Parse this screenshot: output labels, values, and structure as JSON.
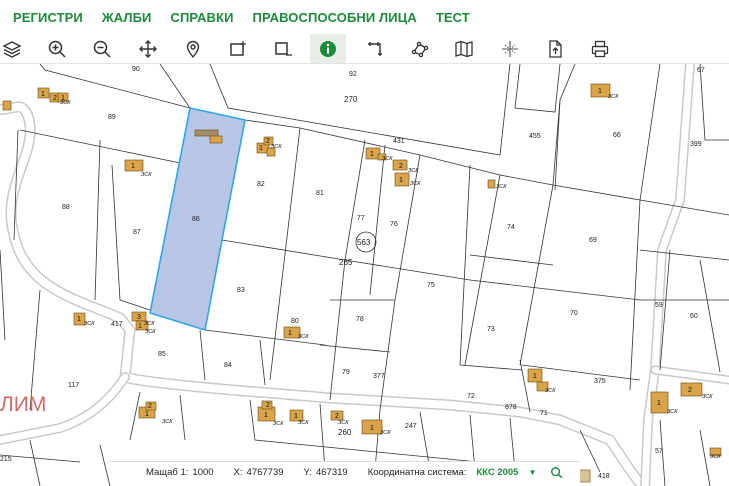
{
  "menu": {
    "items": [
      {
        "label": "РЕГИСТРИ"
      },
      {
        "label": "ЖАЛБИ"
      },
      {
        "label": "СПРАВКИ"
      },
      {
        "label": "ПРАВОСПОСОБНИ ЛИЦА"
      },
      {
        "label": "ТЕСТ"
      }
    ]
  },
  "toolbar": {
    "tools": [
      {
        "icon": "layers-icon"
      },
      {
        "icon": "zoom-in-icon"
      },
      {
        "icon": "zoom-out-icon"
      },
      {
        "icon": "pan-icon"
      },
      {
        "icon": "location-pin-icon"
      },
      {
        "icon": "select-rectangle-icon"
      },
      {
        "icon": "deselect-rectangle-icon"
      },
      {
        "icon": "info-icon",
        "active": true
      },
      {
        "icon": "measure-distance-icon"
      },
      {
        "icon": "measure-area-icon"
      },
      {
        "icon": "map-icon"
      },
      {
        "icon": "coordinates-icon"
      },
      {
        "icon": "export-icon"
      },
      {
        "icon": "print-icon"
      }
    ]
  },
  "map": {
    "selection_color": "#b8c6e6",
    "selection_stroke": "#2fa6e6",
    "building_color": "#d9a44a",
    "road_stroke": "#c9c9c9",
    "parcels": [
      "90",
      "92",
      "270",
      "89",
      "431",
      "455",
      "66",
      "399",
      "67",
      "88",
      "86",
      "82",
      "81",
      "77",
      "76",
      "563",
      "265",
      "87",
      "74",
      "69",
      "83",
      "75",
      "80",
      "78",
      "73",
      "59",
      "70",
      "60",
      "417",
      "85",
      "84",
      "79",
      "377",
      "375",
      "117",
      "72",
      "878",
      "71",
      "260",
      "247",
      "57",
      "418",
      "215"
    ],
    "building_labels": [
      "1",
      "2",
      "3"
    ],
    "building_tag": "ЗСК",
    "watermark": "ЛИМ"
  },
  "status": {
    "scale_label": "Мащаб 1:",
    "scale_value": "1000",
    "x_label": "X:",
    "x_value": "4767739",
    "y_label": "Y:",
    "y_value": "467319",
    "crs_label": "Координатна система:",
    "crs_value": "ККС 2005"
  },
  "colors": {
    "accent": "#1e8a3c"
  }
}
